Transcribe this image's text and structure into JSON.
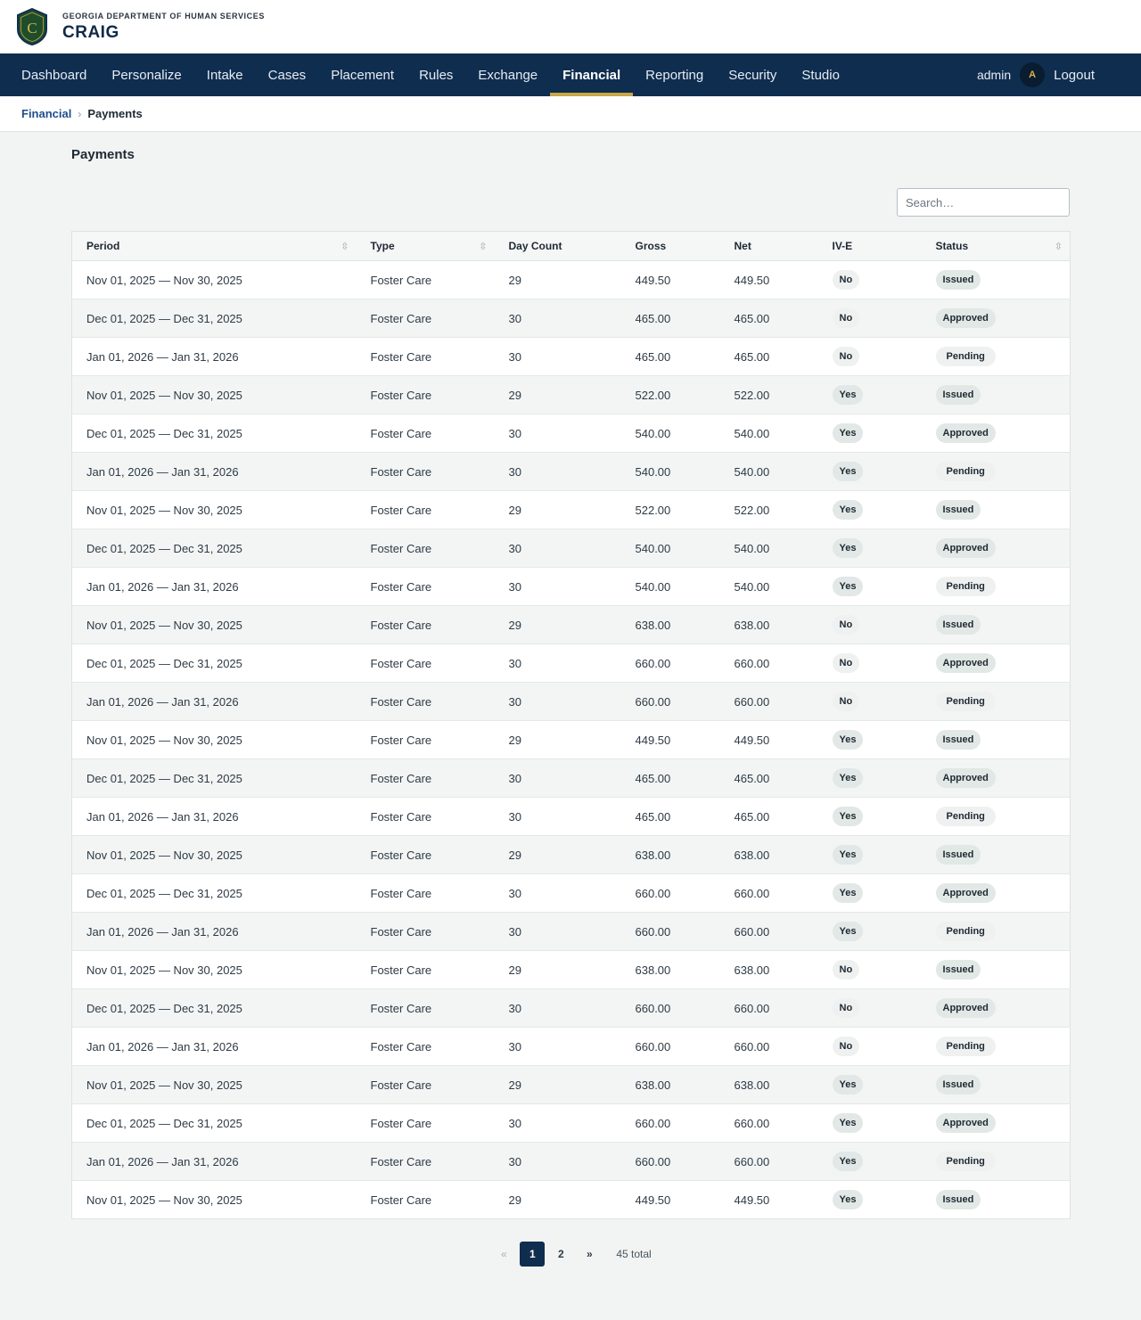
{
  "header": {
    "org": "GEORGIA DEPARTMENT OF HUMAN SERVICES",
    "app": "CRAIG",
    "logo_letter": "C"
  },
  "nav": {
    "items": [
      "Dashboard",
      "Personalize",
      "Intake",
      "Cases",
      "Placement",
      "Rules",
      "Exchange",
      "Financial",
      "Reporting",
      "Security",
      "Studio"
    ],
    "active": "Financial",
    "user": "admin",
    "avatar_initial": "A",
    "logout": "Logout"
  },
  "breadcrumb": {
    "parent": "Financial",
    "separator": "›",
    "current": "Payments"
  },
  "page": {
    "title": "Payments"
  },
  "search": {
    "placeholder": "Search…",
    "value": ""
  },
  "table": {
    "columns": [
      "Period",
      "Type",
      "Day Count",
      "Gross",
      "Net",
      "IV-E",
      "Status"
    ],
    "sortable": [
      true,
      true,
      false,
      false,
      false,
      false,
      true
    ],
    "rows": [
      [
        "Nov 01, 2025 — Nov 30, 2025",
        "Foster Care",
        "29",
        "449.50",
        "449.50",
        "No",
        "Issued"
      ],
      [
        "Dec 01, 2025 — Dec 31, 2025",
        "Foster Care",
        "30",
        "465.00",
        "465.00",
        "No",
        "Approved"
      ],
      [
        "Jan 01, 2026 — Jan 31, 2026",
        "Foster Care",
        "30",
        "465.00",
        "465.00",
        "No",
        "Pending"
      ],
      [
        "Nov 01, 2025 — Nov 30, 2025",
        "Foster Care",
        "29",
        "522.00",
        "522.00",
        "Yes",
        "Issued"
      ],
      [
        "Dec 01, 2025 — Dec 31, 2025",
        "Foster Care",
        "30",
        "540.00",
        "540.00",
        "Yes",
        "Approved"
      ],
      [
        "Jan 01, 2026 — Jan 31, 2026",
        "Foster Care",
        "30",
        "540.00",
        "540.00",
        "Yes",
        "Pending"
      ],
      [
        "Nov 01, 2025 — Nov 30, 2025",
        "Foster Care",
        "29",
        "522.00",
        "522.00",
        "Yes",
        "Issued"
      ],
      [
        "Dec 01, 2025 — Dec 31, 2025",
        "Foster Care",
        "30",
        "540.00",
        "540.00",
        "Yes",
        "Approved"
      ],
      [
        "Jan 01, 2026 — Jan 31, 2026",
        "Foster Care",
        "30",
        "540.00",
        "540.00",
        "Yes",
        "Pending"
      ],
      [
        "Nov 01, 2025 — Nov 30, 2025",
        "Foster Care",
        "29",
        "638.00",
        "638.00",
        "No",
        "Issued"
      ],
      [
        "Dec 01, 2025 — Dec 31, 2025",
        "Foster Care",
        "30",
        "660.00",
        "660.00",
        "No",
        "Approved"
      ],
      [
        "Jan 01, 2026 — Jan 31, 2026",
        "Foster Care",
        "30",
        "660.00",
        "660.00",
        "No",
        "Pending"
      ],
      [
        "Nov 01, 2025 — Nov 30, 2025",
        "Foster Care",
        "29",
        "449.50",
        "449.50",
        "Yes",
        "Issued"
      ],
      [
        "Dec 01, 2025 — Dec 31, 2025",
        "Foster Care",
        "30",
        "465.00",
        "465.00",
        "Yes",
        "Approved"
      ],
      [
        "Jan 01, 2026 — Jan 31, 2026",
        "Foster Care",
        "30",
        "465.00",
        "465.00",
        "Yes",
        "Pending"
      ],
      [
        "Nov 01, 2025 — Nov 30, 2025",
        "Foster Care",
        "29",
        "638.00",
        "638.00",
        "Yes",
        "Issued"
      ],
      [
        "Dec 01, 2025 — Dec 31, 2025",
        "Foster Care",
        "30",
        "660.00",
        "660.00",
        "Yes",
        "Approved"
      ],
      [
        "Jan 01, 2026 — Jan 31, 2026",
        "Foster Care",
        "30",
        "660.00",
        "660.00",
        "Yes",
        "Pending"
      ],
      [
        "Nov 01, 2025 — Nov 30, 2025",
        "Foster Care",
        "29",
        "638.00",
        "638.00",
        "No",
        "Issued"
      ],
      [
        "Dec 01, 2025 — Dec 31, 2025",
        "Foster Care",
        "30",
        "660.00",
        "660.00",
        "No",
        "Approved"
      ],
      [
        "Jan 01, 2026 — Jan 31, 2026",
        "Foster Care",
        "30",
        "660.00",
        "660.00",
        "No",
        "Pending"
      ],
      [
        "Nov 01, 2025 — Nov 30, 2025",
        "Foster Care",
        "29",
        "638.00",
        "638.00",
        "Yes",
        "Issued"
      ],
      [
        "Dec 01, 2025 — Dec 31, 2025",
        "Foster Care",
        "30",
        "660.00",
        "660.00",
        "Yes",
        "Approved"
      ],
      [
        "Jan 01, 2026 — Jan 31, 2026",
        "Foster Care",
        "30",
        "660.00",
        "660.00",
        "Yes",
        "Pending"
      ],
      [
        "Nov 01, 2025 — Nov 30, 2025",
        "Foster Care",
        "29",
        "449.50",
        "449.50",
        "Yes",
        "Issued"
      ]
    ]
  },
  "pagination": {
    "prev": "«",
    "pages": [
      "1",
      "2"
    ],
    "current": "1",
    "next": "»",
    "total": "45 total"
  },
  "icons": {
    "sort": "sort-updown-icon",
    "logo": "shield-logo-icon"
  },
  "colors": {
    "nav_bg": "#0f2d4f",
    "accent": "#c9a646",
    "shield": "#1e4d2b"
  }
}
